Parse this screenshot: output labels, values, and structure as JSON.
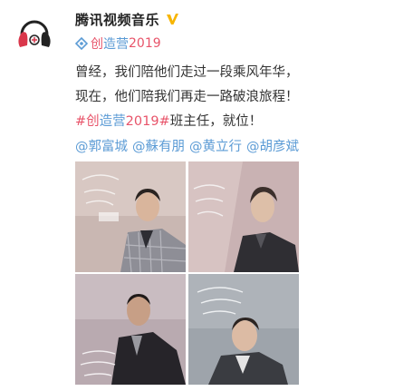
{
  "post": {
    "author": "腾讯视频音乐",
    "verified_icon": "verified-v-icon",
    "topic": {
      "hash": "#",
      "part1": "创",
      "part2": "造营",
      "part3": "2019"
    },
    "lines": [
      "曾经，我们陪他们走过一段乘风年华，",
      "现在，他们陪我们再走一路破浪旅程！"
    ],
    "line3": {
      "tag_a": "#创",
      "tag_b": "造营",
      "tag_c": "2019#",
      "rest": "班主任，就位！"
    },
    "mentions": [
      "@郭富城",
      "@蘇有朋",
      "@黄立行",
      "@胡彦斌"
    ]
  },
  "photos": [
    {
      "icon": "photo-1-man-checked-suit"
    },
    {
      "icon": "photo-2-man-dark-shirt"
    },
    {
      "icon": "photo-3-man-leather-jacket"
    },
    {
      "icon": "photo-4-man-white-shirt"
    }
  ],
  "colors": {
    "accent_red": "#e8546a",
    "link_blue": "#5b9bd5",
    "text": "#333333"
  }
}
